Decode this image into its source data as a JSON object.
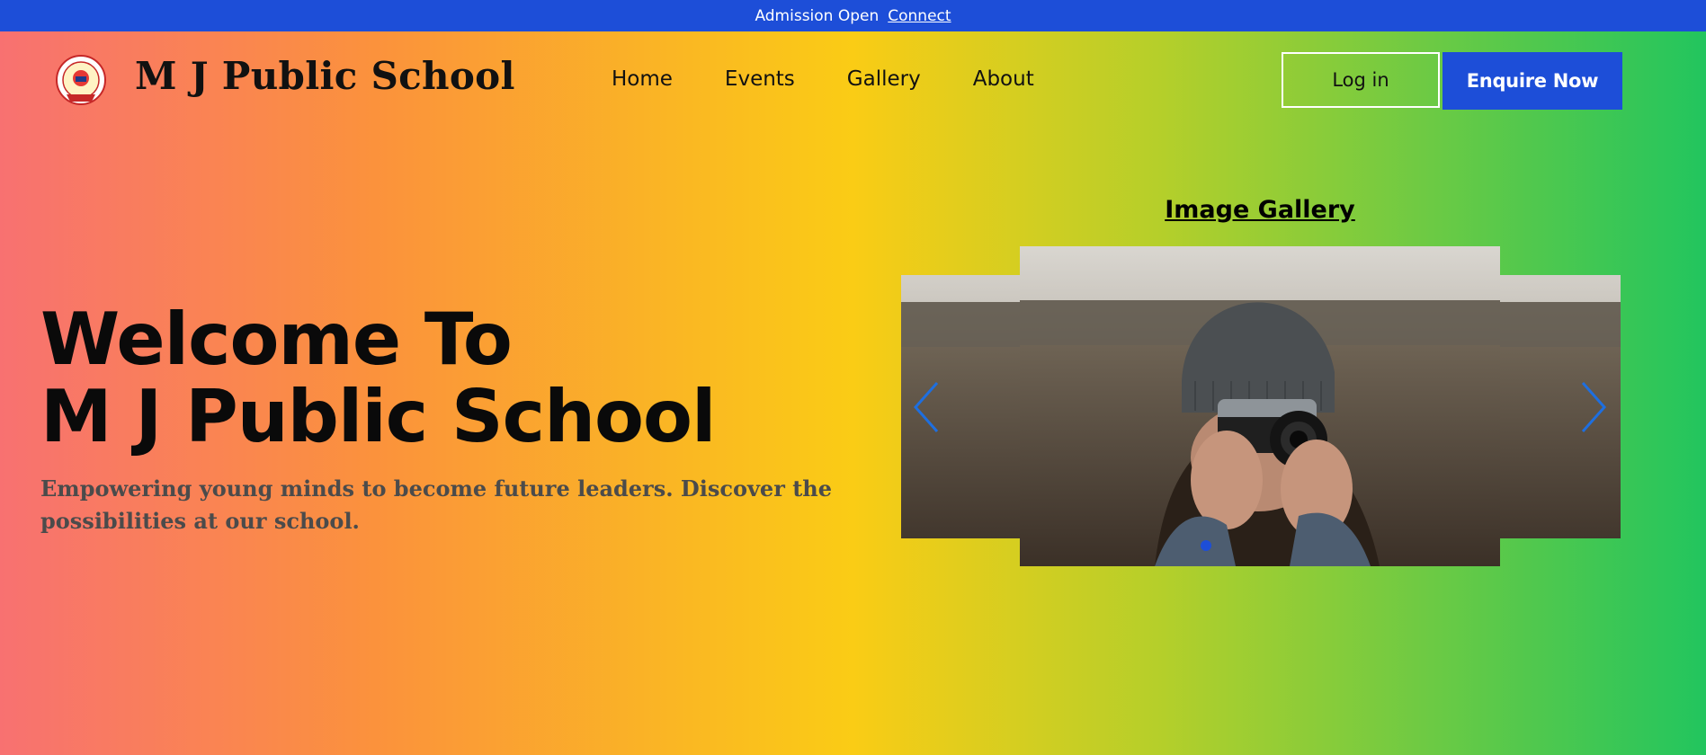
{
  "topbar": {
    "text": "Admission Open",
    "link_label": "Connect",
    "bg_color": "#1d4ed8"
  },
  "header": {
    "logo_icon": "school-emblem-icon",
    "school_name": "M J Public School",
    "nav": [
      {
        "label": "Home"
      },
      {
        "label": "Events"
      },
      {
        "label": "Gallery"
      },
      {
        "label": "About"
      }
    ],
    "login_label": "Log in",
    "enquire_label": "Enquire Now",
    "accent_color": "#1d4ed8"
  },
  "hero": {
    "title_line1": "Welcome To",
    "title_line2": "M J Public School",
    "subtitle": "Empowering young minds to become future leaders. Discover the possibilities at our school."
  },
  "gallery": {
    "title": "Image Gallery",
    "prev_icon": "chevron-left-icon",
    "next_icon": "chevron-right-icon",
    "image_subject": "photographer-with-camera",
    "active_slide": 1
  }
}
